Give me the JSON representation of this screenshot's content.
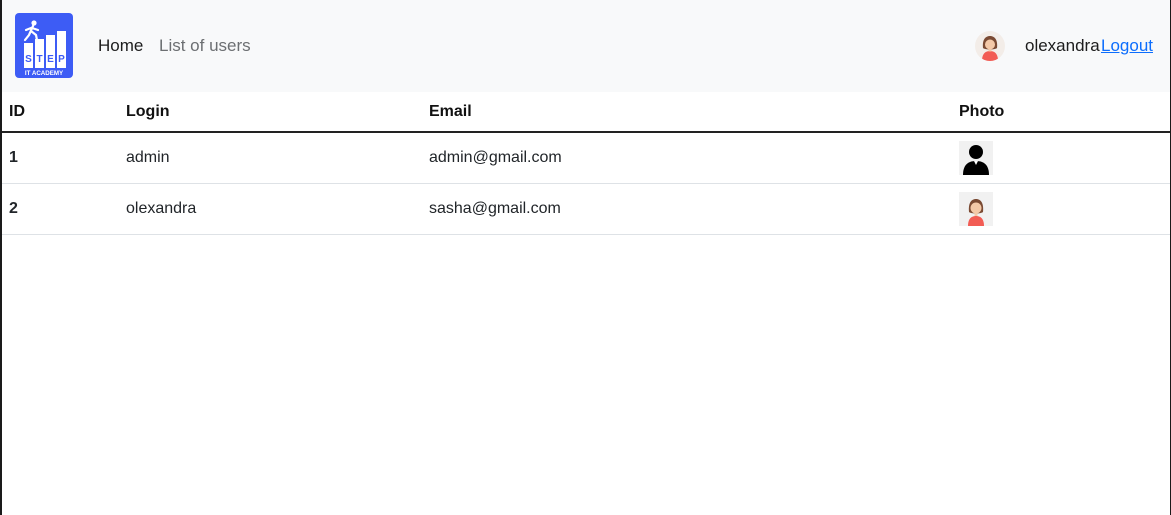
{
  "navbar": {
    "logo": {
      "icon": "step-it-academy-logo",
      "text_top": "STEP",
      "text_bottom": "IT ACADEMY"
    },
    "links": [
      {
        "label": "Home",
        "active": true
      },
      {
        "label": "List of users",
        "active": false
      }
    ],
    "user": {
      "name": "olexandra",
      "logout_label": "Logout",
      "avatar_icon": "female-avatar-icon"
    }
  },
  "table": {
    "headers": [
      "ID",
      "Login",
      "Email",
      "Photo"
    ],
    "rows": [
      {
        "id": "1",
        "login": "admin",
        "email": "admin@gmail.com",
        "photo_icon": "male-silhouette-icon"
      },
      {
        "id": "2",
        "login": "olexandra",
        "email": "sasha@gmail.com",
        "photo_icon": "female-avatar-icon"
      }
    ]
  },
  "colors": {
    "navbar_bg": "#f8f9fa",
    "logo_bg": "#3d5cf5",
    "link_active": "#1d1d1d",
    "link_muted": "#6c6f72",
    "logout_link": "#0d6efd"
  }
}
